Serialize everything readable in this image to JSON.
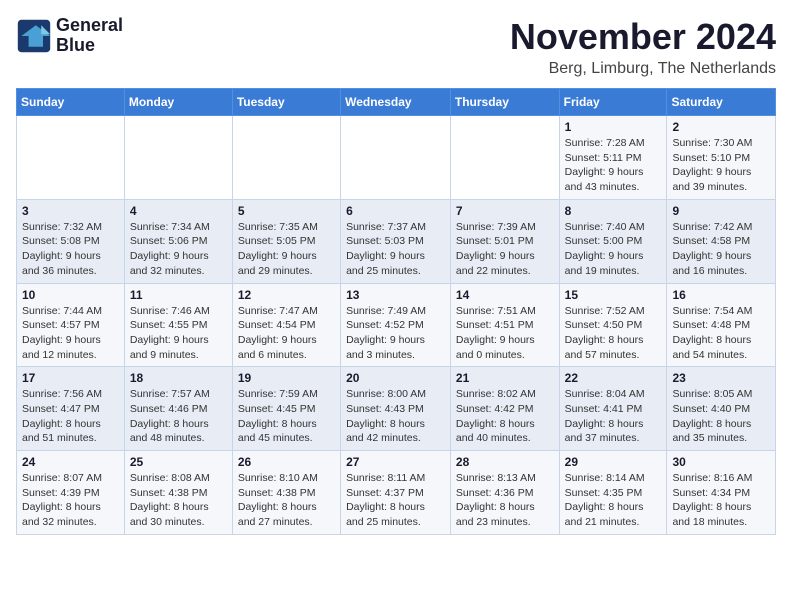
{
  "logo": {
    "line1": "General",
    "line2": "Blue"
  },
  "title": "November 2024",
  "location": "Berg, Limburg, The Netherlands",
  "weekdays": [
    "Sunday",
    "Monday",
    "Tuesday",
    "Wednesday",
    "Thursday",
    "Friday",
    "Saturday"
  ],
  "weeks": [
    [
      {
        "day": "",
        "info": ""
      },
      {
        "day": "",
        "info": ""
      },
      {
        "day": "",
        "info": ""
      },
      {
        "day": "",
        "info": ""
      },
      {
        "day": "",
        "info": ""
      },
      {
        "day": "1",
        "info": "Sunrise: 7:28 AM\nSunset: 5:11 PM\nDaylight: 9 hours\nand 43 minutes."
      },
      {
        "day": "2",
        "info": "Sunrise: 7:30 AM\nSunset: 5:10 PM\nDaylight: 9 hours\nand 39 minutes."
      }
    ],
    [
      {
        "day": "3",
        "info": "Sunrise: 7:32 AM\nSunset: 5:08 PM\nDaylight: 9 hours\nand 36 minutes."
      },
      {
        "day": "4",
        "info": "Sunrise: 7:34 AM\nSunset: 5:06 PM\nDaylight: 9 hours\nand 32 minutes."
      },
      {
        "day": "5",
        "info": "Sunrise: 7:35 AM\nSunset: 5:05 PM\nDaylight: 9 hours\nand 29 minutes."
      },
      {
        "day": "6",
        "info": "Sunrise: 7:37 AM\nSunset: 5:03 PM\nDaylight: 9 hours\nand 25 minutes."
      },
      {
        "day": "7",
        "info": "Sunrise: 7:39 AM\nSunset: 5:01 PM\nDaylight: 9 hours\nand 22 minutes."
      },
      {
        "day": "8",
        "info": "Sunrise: 7:40 AM\nSunset: 5:00 PM\nDaylight: 9 hours\nand 19 minutes."
      },
      {
        "day": "9",
        "info": "Sunrise: 7:42 AM\nSunset: 4:58 PM\nDaylight: 9 hours\nand 16 minutes."
      }
    ],
    [
      {
        "day": "10",
        "info": "Sunrise: 7:44 AM\nSunset: 4:57 PM\nDaylight: 9 hours\nand 12 minutes."
      },
      {
        "day": "11",
        "info": "Sunrise: 7:46 AM\nSunset: 4:55 PM\nDaylight: 9 hours\nand 9 minutes."
      },
      {
        "day": "12",
        "info": "Sunrise: 7:47 AM\nSunset: 4:54 PM\nDaylight: 9 hours\nand 6 minutes."
      },
      {
        "day": "13",
        "info": "Sunrise: 7:49 AM\nSunset: 4:52 PM\nDaylight: 9 hours\nand 3 minutes."
      },
      {
        "day": "14",
        "info": "Sunrise: 7:51 AM\nSunset: 4:51 PM\nDaylight: 9 hours\nand 0 minutes."
      },
      {
        "day": "15",
        "info": "Sunrise: 7:52 AM\nSunset: 4:50 PM\nDaylight: 8 hours\nand 57 minutes."
      },
      {
        "day": "16",
        "info": "Sunrise: 7:54 AM\nSunset: 4:48 PM\nDaylight: 8 hours\nand 54 minutes."
      }
    ],
    [
      {
        "day": "17",
        "info": "Sunrise: 7:56 AM\nSunset: 4:47 PM\nDaylight: 8 hours\nand 51 minutes."
      },
      {
        "day": "18",
        "info": "Sunrise: 7:57 AM\nSunset: 4:46 PM\nDaylight: 8 hours\nand 48 minutes."
      },
      {
        "day": "19",
        "info": "Sunrise: 7:59 AM\nSunset: 4:45 PM\nDaylight: 8 hours\nand 45 minutes."
      },
      {
        "day": "20",
        "info": "Sunrise: 8:00 AM\nSunset: 4:43 PM\nDaylight: 8 hours\nand 42 minutes."
      },
      {
        "day": "21",
        "info": "Sunrise: 8:02 AM\nSunset: 4:42 PM\nDaylight: 8 hours\nand 40 minutes."
      },
      {
        "day": "22",
        "info": "Sunrise: 8:04 AM\nSunset: 4:41 PM\nDaylight: 8 hours\nand 37 minutes."
      },
      {
        "day": "23",
        "info": "Sunrise: 8:05 AM\nSunset: 4:40 PM\nDaylight: 8 hours\nand 35 minutes."
      }
    ],
    [
      {
        "day": "24",
        "info": "Sunrise: 8:07 AM\nSunset: 4:39 PM\nDaylight: 8 hours\nand 32 minutes."
      },
      {
        "day": "25",
        "info": "Sunrise: 8:08 AM\nSunset: 4:38 PM\nDaylight: 8 hours\nand 30 minutes."
      },
      {
        "day": "26",
        "info": "Sunrise: 8:10 AM\nSunset: 4:38 PM\nDaylight: 8 hours\nand 27 minutes."
      },
      {
        "day": "27",
        "info": "Sunrise: 8:11 AM\nSunset: 4:37 PM\nDaylight: 8 hours\nand 25 minutes."
      },
      {
        "day": "28",
        "info": "Sunrise: 8:13 AM\nSunset: 4:36 PM\nDaylight: 8 hours\nand 23 minutes."
      },
      {
        "day": "29",
        "info": "Sunrise: 8:14 AM\nSunset: 4:35 PM\nDaylight: 8 hours\nand 21 minutes."
      },
      {
        "day": "30",
        "info": "Sunrise: 8:16 AM\nSunset: 4:34 PM\nDaylight: 8 hours\nand 18 minutes."
      }
    ]
  ]
}
